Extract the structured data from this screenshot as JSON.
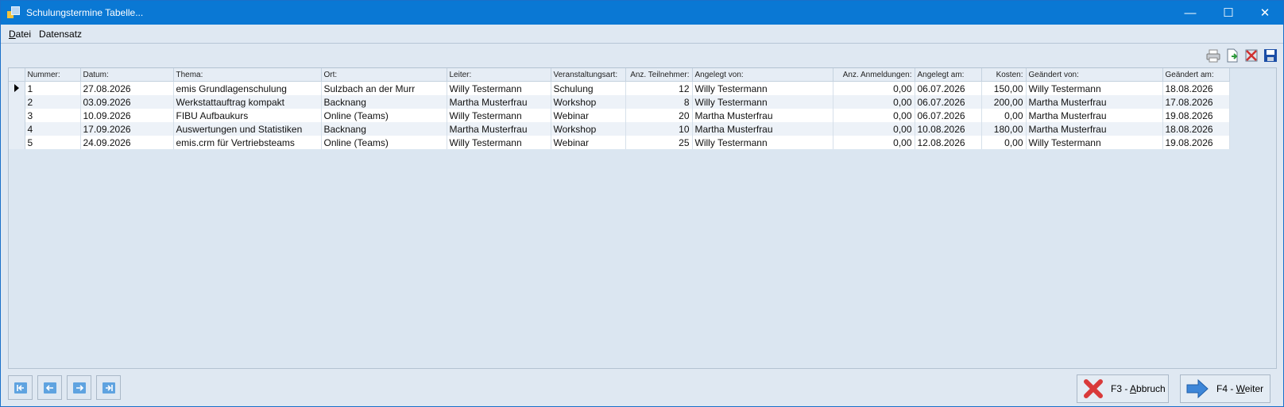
{
  "window": {
    "title": "Schulungstermine Tabelle...",
    "minimize_glyph": "—",
    "maximize_glyph": "☐",
    "close_glyph": "✕"
  },
  "menu": [
    {
      "label": "Datei",
      "access_key": "D",
      "rest": "atei"
    },
    {
      "label": "Datensatz",
      "access_key": "",
      "rest": "Datensatz"
    }
  ],
  "toolbar": {
    "icons": [
      "print-icon",
      "export-icon",
      "delete-icon",
      "save-icon"
    ]
  },
  "table": {
    "columns": [
      {
        "key": "nummer",
        "label": "Nummer:",
        "align": "left"
      },
      {
        "key": "datum",
        "label": "Datum:",
        "align": "left"
      },
      {
        "key": "thema",
        "label": "Thema:",
        "align": "left"
      },
      {
        "key": "ort",
        "label": "Ort:",
        "align": "left"
      },
      {
        "key": "leiter",
        "label": "Leiter:",
        "align": "left"
      },
      {
        "key": "art",
        "label": "Veranstaltungsart:",
        "align": "left"
      },
      {
        "key": "teilnehmer",
        "label": "Anz. Teilnehmer:",
        "align": "right"
      },
      {
        "key": "angelegt_von",
        "label": "Angelegt von:",
        "align": "left"
      },
      {
        "key": "anmeldungen",
        "label": "Anz. Anmeldungen:",
        "align": "right"
      },
      {
        "key": "angelegt_am",
        "label": "Angelegt am:",
        "align": "left"
      },
      {
        "key": "kosten",
        "label": "Kosten:",
        "align": "right"
      },
      {
        "key": "geaendert_von",
        "label": "Geändert von:",
        "align": "left"
      },
      {
        "key": "geaendert_am",
        "label": "Geändert am:",
        "align": "left"
      }
    ],
    "rows": [
      [
        "1",
        "27.08.2026",
        "emis Grundlagenschulung",
        "Sulzbach an der Murr",
        "Willy Testermann",
        "Schulung",
        "12",
        "Willy Testermann",
        "0,00",
        "06.07.2026",
        "150,00",
        "Willy Testermann",
        "18.08.2026"
      ],
      [
        "2",
        "03.09.2026",
        "Werkstattauftrag kompakt",
        "Backnang",
        "Martha Musterfrau",
        "Workshop",
        "8",
        "Willy Testermann",
        "0,00",
        "06.07.2026",
        "200,00",
        "Martha Musterfrau",
        "17.08.2026"
      ],
      [
        "3",
        "10.09.2026",
        "FIBU Aufbaukurs",
        "Online (Teams)",
        "Willy Testermann",
        "Webinar",
        "20",
        "Martha Musterfrau",
        "0,00",
        "06.07.2026",
        "0,00",
        "Martha Musterfrau",
        "19.08.2026"
      ],
      [
        "4",
        "17.09.2026",
        "Auswertungen und Statistiken",
        "Backnang",
        "Martha Musterfrau",
        "Workshop",
        "10",
        "Martha Musterfrau",
        "0,00",
        "10.08.2026",
        "180,00",
        "Martha Musterfrau",
        "18.08.2026"
      ],
      [
        "5",
        "24.09.2026",
        "emis.crm für Vertriebsteams",
        "Online (Teams)",
        "Willy Testermann",
        "Webinar",
        "25",
        "Willy Testermann",
        "0,00",
        "12.08.2026",
        "0,00",
        "Willy Testermann",
        "19.08.2026"
      ]
    ],
    "selected_row": 0
  },
  "nav": {
    "icons": [
      "first-record-icon",
      "previous-record-icon",
      "next-record-icon",
      "last-record-icon"
    ]
  },
  "buttons": {
    "cancel": {
      "prefix": "F3 - ",
      "access_key": "A",
      "rest": "bbruch"
    },
    "next": {
      "prefix": "F4 - ",
      "access_key": "W",
      "rest": "eiter"
    }
  },
  "colors": {
    "titlebar": "#0a78d4",
    "cancel_icon": "#d93a3a",
    "next_icon": "#3d86d8"
  }
}
